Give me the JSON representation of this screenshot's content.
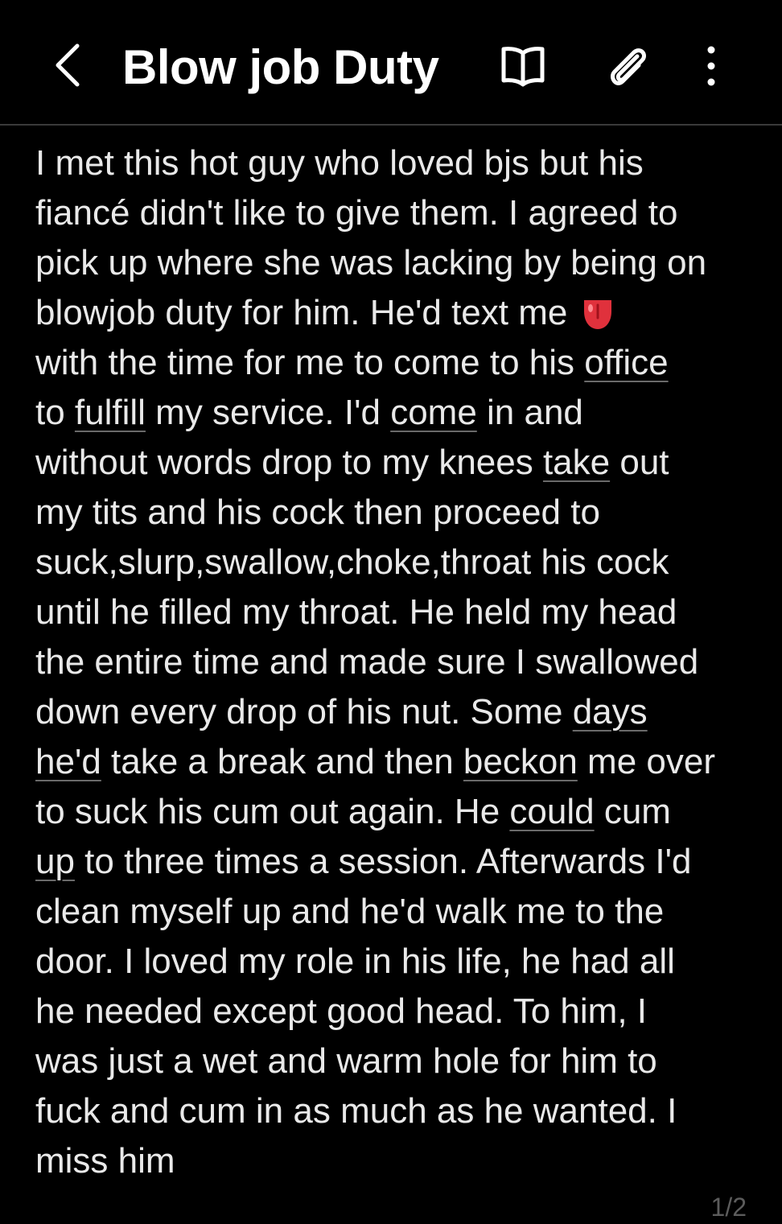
{
  "header": {
    "title": "Blow job Duty",
    "back_icon": "chevron-left-icon",
    "reading_icon": "book-icon",
    "attach_icon": "paperclip-icon",
    "more_icon": "more-vertical-icon"
  },
  "note": {
    "lines": [
      [
        {
          "t": "I met this hot guy who loved bjs but his"
        }
      ],
      [
        {
          "t": "fiancé didn't like to give them. I agreed to"
        }
      ],
      [
        {
          "t": "pick up where she was lacking by being on"
        }
      ],
      [
        {
          "t": "blowjob duty for him. He'd text me "
        }
      ],
      [
        {
          "t": "with the time for me to come to his "
        },
        {
          "t": "office",
          "u": true
        }
      ],
      [
        {
          "t": "to "
        },
        {
          "t": "fulfill",
          "u": true
        },
        {
          "t": " my service. I'd "
        },
        {
          "t": "come",
          "u": true
        },
        {
          "t": " in and"
        }
      ],
      [
        {
          "t": "without words drop to my knees "
        },
        {
          "t": "take",
          "u": true
        },
        {
          "t": " out"
        }
      ],
      [
        {
          "t": "my tits and his cock then proceed to"
        }
      ],
      [
        {
          "t": "suck,slurp,swallow,choke,throat his cock"
        }
      ],
      [
        {
          "t": "until he filled my throat. He held my head"
        }
      ],
      [
        {
          "t": "the entire time and made sure I swallowed"
        }
      ],
      [
        {
          "t": "down every drop of his nut. Some "
        },
        {
          "t": "days",
          "u": true
        }
      ],
      [
        {
          "t": "he'd",
          "u": true
        },
        {
          "t": " take a break and then "
        },
        {
          "t": "beckon",
          "u": true
        },
        {
          "t": " me over"
        }
      ],
      [
        {
          "t": "to suck his cum out again. He "
        },
        {
          "t": "could",
          "u": true
        },
        {
          "t": " cum"
        }
      ],
      [
        {
          "t": "up",
          "u": true
        },
        {
          "t": " to three times a session. Afterwards I'd"
        }
      ],
      [
        {
          "t": "clean myself up and he'd walk me to the"
        }
      ],
      [
        {
          "t": "door. I loved my role in his life, he had all"
        }
      ],
      [
        {
          "t": "he needed except good head. To him, I"
        }
      ],
      [
        {
          "t": "was just a wet and warm hole for him to"
        }
      ],
      [
        {
          "t": "fuck and cum in as much as he wanted. I"
        }
      ],
      [
        {
          "t": "miss him"
        }
      ]
    ],
    "emoji_after_line": 3,
    "emoji_icon": "tongue-emoji-icon"
  },
  "pagination": {
    "indicator": "1/2"
  },
  "colors": {
    "background": "#000000",
    "text": "#e9e9e9",
    "title": "#ffffff",
    "underline": "#6a6a6a",
    "page_indicator": "#5c5c5c",
    "emoji": "#e0313c"
  }
}
